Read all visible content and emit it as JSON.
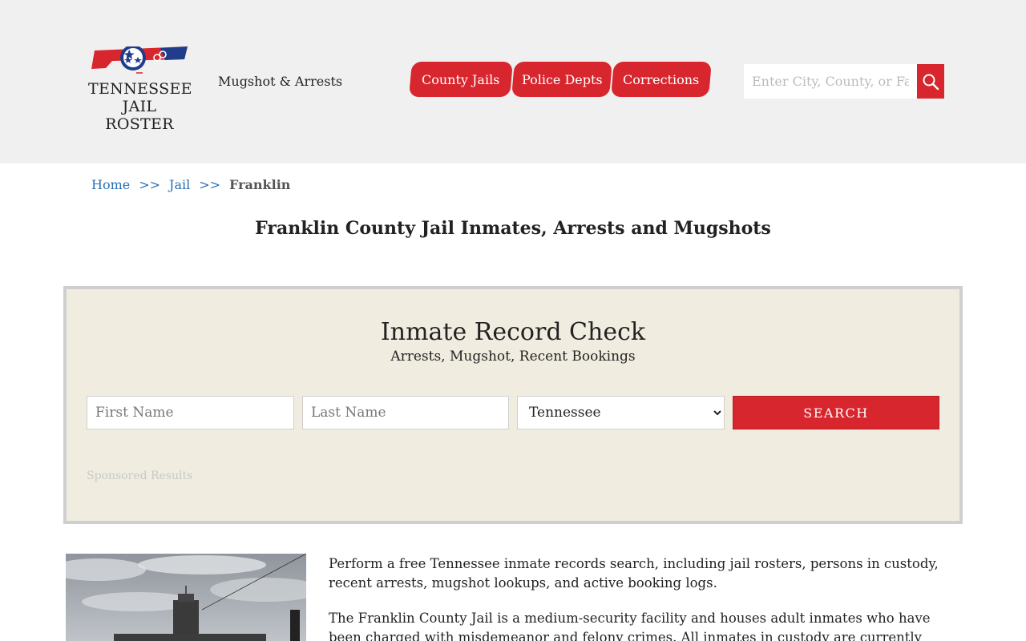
{
  "header": {
    "logo": {
      "line1": "TENNESSEE",
      "line2": "JAIL ROSTER"
    },
    "tagline": "Mugshot & Arrests",
    "nav": [
      "County Jails",
      "Police Depts",
      "Corrections"
    ],
    "search": {
      "placeholder": "Enter City, County, or Facility"
    }
  },
  "breadcrumb": {
    "home": "Home",
    "sep": ">>",
    "jail": "Jail",
    "current": "Franklin"
  },
  "page_title": "Franklin County Jail Inmates, Arrests and Mugshots",
  "record_check": {
    "title": "Inmate Record Check",
    "subtitle": "Arrests, Mugshot, Recent Bookings",
    "first_name_placeholder": "First Name",
    "last_name_placeholder": "Last Name",
    "state_selected": "Tennessee",
    "search_label": "SEARCH",
    "sponsored": "Sponsored Results"
  },
  "content": {
    "paragraph1": "Perform a free Tennessee inmate records search, including jail rosters, persons in custody, recent arrests, mugshot lookups, and active booking logs.",
    "paragraph2": "The Franklin County Jail is a medium-security facility and houses adult inmates who have been charged with misdemeanor and felony crimes. All inmates in custody are currently awaiting trial or"
  },
  "colors": {
    "accent": "#d8262e",
    "panel": "#f0ede0",
    "header_bg": "#f0f0f0",
    "link": "#2a6fb3"
  }
}
